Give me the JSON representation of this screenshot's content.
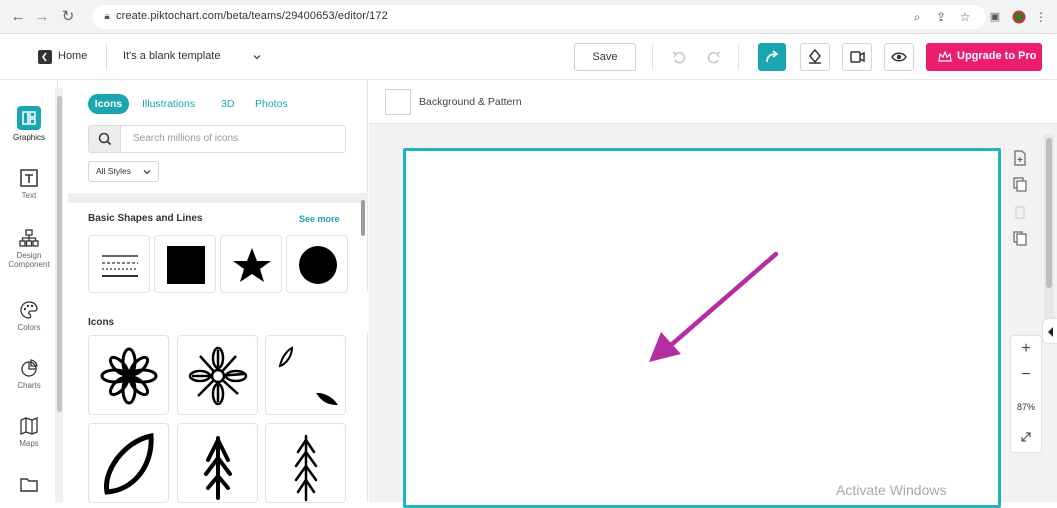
{
  "browser": {
    "url": "create.piktochart.com/beta/teams/29400653/editor/172",
    "icons": [
      "back-arrow-icon",
      "forward-arrow-icon",
      "reload-icon",
      "lock-icon",
      "zoom-icon",
      "share-icon",
      "star-icon",
      "sidepanel-icon",
      "profile-icon",
      "menu-icon"
    ]
  },
  "header": {
    "home_label": "Home",
    "template_title": "It's a blank template",
    "save_label": "Save",
    "upgrade_label": "Upgrade to Pro"
  },
  "rail": {
    "items": [
      {
        "label": "Graphics"
      },
      {
        "label": "Text"
      },
      {
        "label": "Design\nComponent"
      },
      {
        "label": "Colors"
      },
      {
        "label": "Charts"
      },
      {
        "label": "Maps"
      }
    ]
  },
  "panel": {
    "tabs": [
      {
        "label": "Icons"
      },
      {
        "label": "Illustrations"
      },
      {
        "label": "3D"
      },
      {
        "label": "Photos"
      }
    ],
    "search_placeholder": "Search millions of icons",
    "style_filter": "All Styles",
    "shapes_heading": "Basic Shapes and Lines",
    "see_more": "See more",
    "icons_heading": "Icons"
  },
  "canvas": {
    "background_label": "Background & Pattern",
    "zoom_in": "+",
    "zoom_out": "−",
    "zoom_level": "87%"
  },
  "overlay": {
    "watermark": "Activate Windows"
  },
  "colors": {
    "accent_teal": "#1aa6b0",
    "upgrade_pink": "#ec1d6e",
    "arrow_purple": "#b52ea1"
  }
}
